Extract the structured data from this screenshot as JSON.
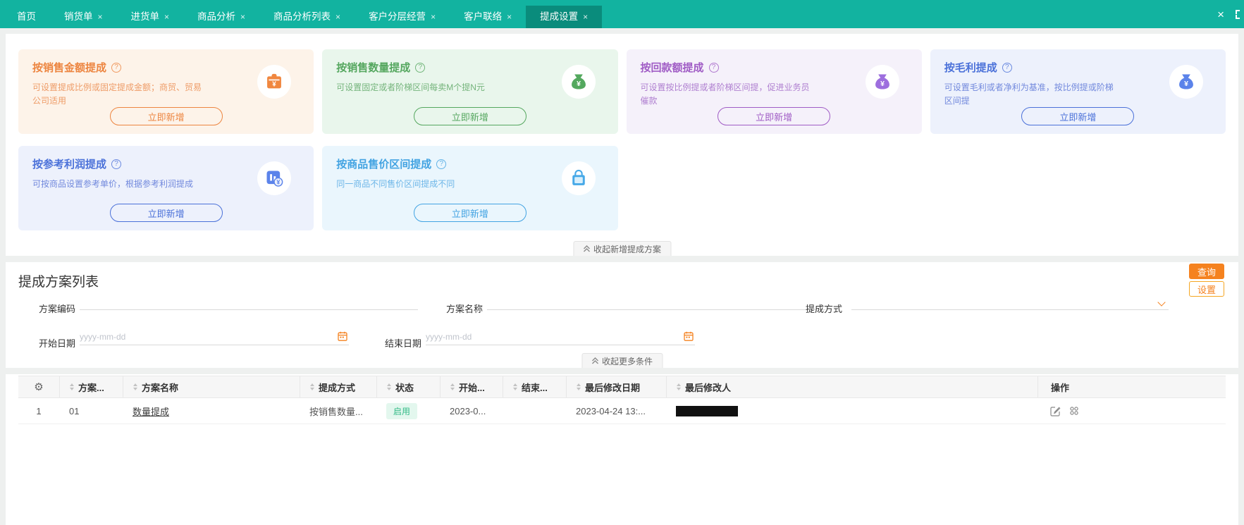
{
  "colors": {
    "topbar_teal": "#12b3a0",
    "active_tab_teal": "#0a8c7c",
    "accent_orange": "#f5821f",
    "status_enabled_green": "#33bb87",
    "card_orange": "#ed8540",
    "card_green": "#55a75f",
    "card_purple": "#a05cc5",
    "card_blue": "#4b71d9",
    "card_sky": "#42a3e2"
  },
  "icons": {
    "help": "?",
    "gear": "⚙",
    "close": "×"
  },
  "tabbar": {
    "close_glyph": "×",
    "tabs": [
      {
        "label": "首页",
        "closable": false,
        "active": false
      },
      {
        "label": "销货单",
        "closable": true,
        "active": false
      },
      {
        "label": "进货单",
        "closable": true,
        "active": false
      },
      {
        "label": "商品分析",
        "closable": true,
        "active": false
      },
      {
        "label": "商品分析列表",
        "closable": true,
        "active": false
      },
      {
        "label": "客户分层经营",
        "closable": true,
        "active": false
      },
      {
        "label": "客户联络",
        "closable": true,
        "active": false
      },
      {
        "label": "提成设置",
        "closable": true,
        "active": true
      }
    ]
  },
  "cards": [
    {
      "title": "按销售金额提成",
      "desc": "可设置提成比例或固定提成金额；商贸、贸易公司适用",
      "button": "立即新增",
      "icon": "money-case"
    },
    {
      "title": "按销售数量提成",
      "desc": "可设置固定或者阶梯区间每卖M个提N元",
      "button": "立即新增",
      "icon": "money-bag"
    },
    {
      "title": "按回款额提成",
      "desc": "可设置按比例提或者阶梯区间提，促进业务员催款",
      "button": "立即新增",
      "icon": "money-bag"
    },
    {
      "title": "按毛利提成",
      "desc": "可设置毛利或者净利为基准，按比例提或阶梯区间提",
      "button": "立即新增",
      "icon": "money-bag"
    },
    {
      "title": "按参考利润提成",
      "desc": "可按商品设置参考单价，根据参考利润提成",
      "button": "立即新增",
      "icon": "chart-coin"
    },
    {
      "title": "按商品售价区间提成",
      "desc": "同一商品不同售价区间提成不同",
      "button": "立即新增",
      "icon": "shopping-bag"
    }
  ],
  "collapse_cards_label": "收起新增提成方案",
  "list_section": {
    "title": "提成方案列表",
    "filters": {
      "plan_code_label": "方案编码",
      "plan_name_label": "方案名称",
      "method_label": "提成方式",
      "start_date_label": "开始日期",
      "end_date_label": "结束日期",
      "date_placeholder": "yyyy-mm-dd",
      "search_button": "查询",
      "settings_button": "设置",
      "collapse_label": "收起更多条件"
    },
    "table": {
      "columns": {
        "code": "方案...",
        "name": "方案名称",
        "method": "提成方式",
        "status": "状态",
        "start": "开始...",
        "end": "结束...",
        "modified_date": "最后修改日期",
        "modified_by": "最后修改人",
        "actions": "操作"
      },
      "rows": [
        {
          "index": "1",
          "code": "01",
          "name": "数量提成",
          "method": "按销售数量...",
          "status": "启用",
          "start": "2023-0...",
          "end": "",
          "modified_date": "2023-04-24 13:...",
          "modified_by": ""
        }
      ]
    }
  }
}
